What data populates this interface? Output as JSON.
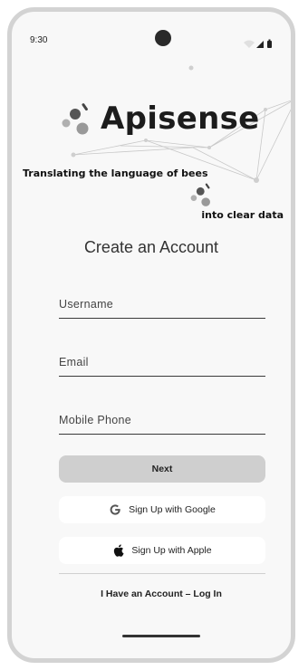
{
  "status_bar": {
    "time": "9:30",
    "icons": [
      "wifi-icon",
      "signal-icon",
      "battery-icon"
    ]
  },
  "brand": {
    "name": "Apisense",
    "tagline_line1": "Translating the language of bees",
    "tagline_line2": "into clear data",
    "logo_icon": "bee-dots-logo-icon"
  },
  "form": {
    "title": "Create an Account",
    "username_placeholder": "Username",
    "email_placeholder": "Email",
    "phone_placeholder": "Mobile Phone",
    "next_label": "Next",
    "google_label": "Sign Up with Google",
    "apple_label": "Sign Up with Apple",
    "login_link": "I Have an Account – Log In"
  },
  "colors": {
    "background": "#f8f8f8",
    "frame": "#d3d3d3",
    "primary_button": "#cfcfcf",
    "text_dark": "#1c1c1c"
  }
}
